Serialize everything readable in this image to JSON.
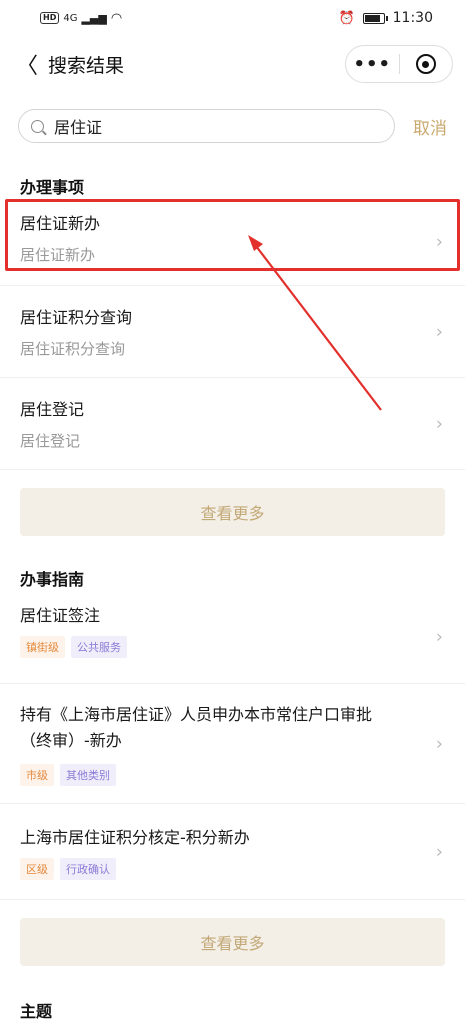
{
  "status": {
    "network": "4G",
    "hd": "HD",
    "time": "11:30"
  },
  "nav": {
    "title": "搜索结果",
    "more": "•••"
  },
  "search": {
    "value": "居住证",
    "cancel": "取消"
  },
  "section1": {
    "title": "办理事项",
    "items": [
      {
        "title": "居住证新办",
        "sub": "居住证新办"
      },
      {
        "title": "居住证积分查询",
        "sub": "居住证积分查询"
      },
      {
        "title": "居住登记",
        "sub": "居住登记"
      }
    ],
    "more": "查看更多"
  },
  "section2": {
    "title": "办事指南",
    "items": [
      {
        "title": "居住证签注",
        "tag1": "镇街级",
        "tag2": "公共服务"
      },
      {
        "title": "持有《上海市居住证》人员申办本市常住户口审批（终审）-新办",
        "tag1": "市级",
        "tag2": "其他类别"
      },
      {
        "title": "上海市居住证积分核定-积分新办",
        "tag1": "区级",
        "tag2": "行政确认"
      }
    ],
    "more": "查看更多"
  },
  "section3": {
    "title": "主题"
  },
  "colors": {
    "accent": "#c9a96e",
    "highlight": "#e3302c"
  },
  "icons": {
    "back": "chevron-left-icon",
    "chevron": "chevron-right-icon",
    "search": "search-icon",
    "close": "target-icon"
  }
}
